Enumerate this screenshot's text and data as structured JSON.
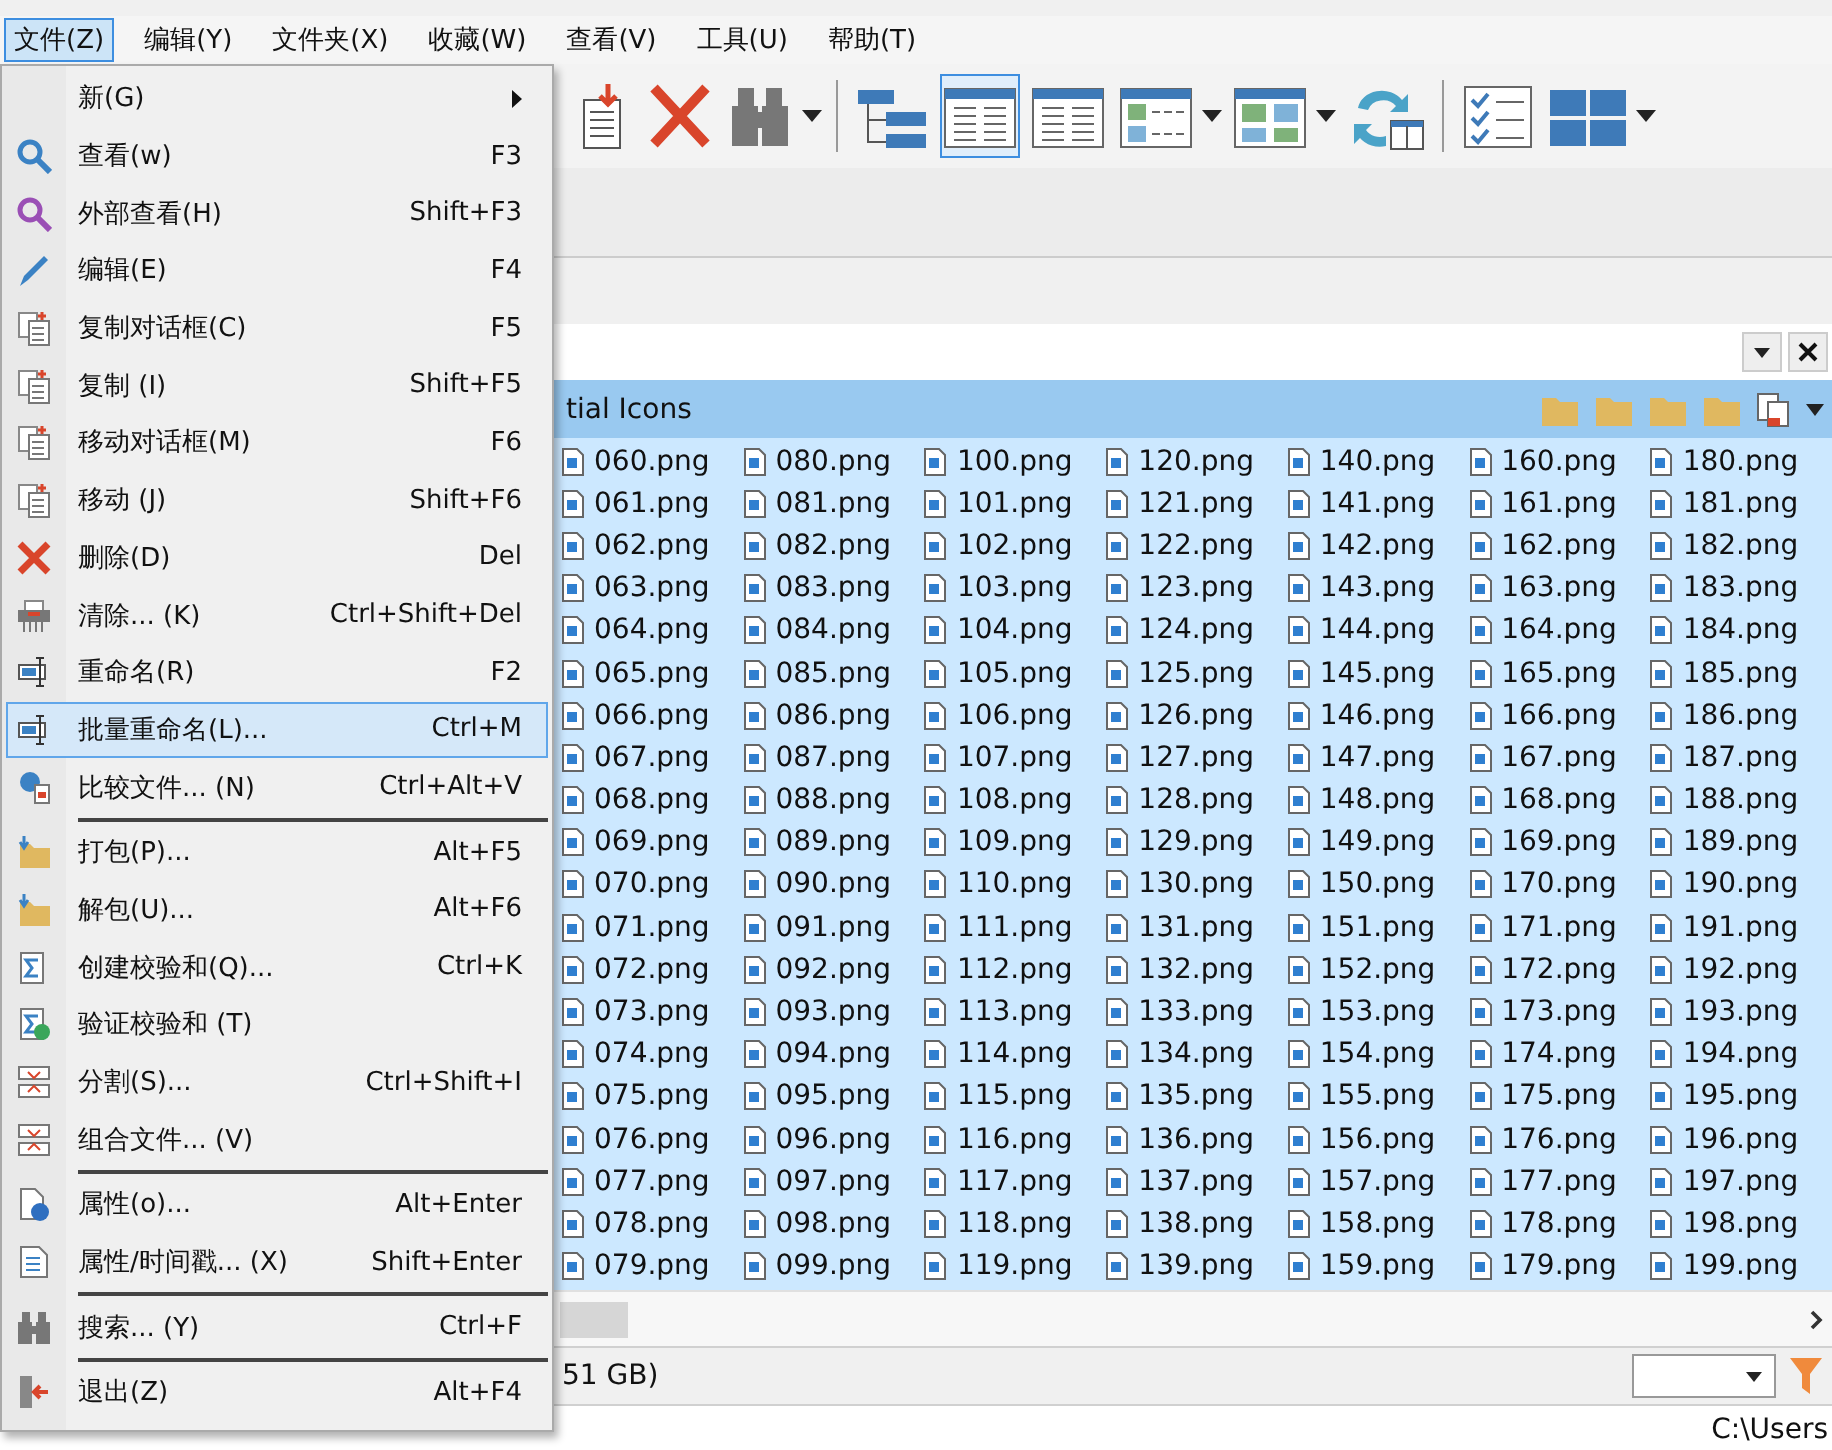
{
  "menubar": [
    {
      "label": "文件(Z)",
      "selected": true
    },
    {
      "label": "编辑(Y)",
      "selected": false
    },
    {
      "label": "文件夹(X)",
      "selected": false
    },
    {
      "label": "收藏(W)",
      "selected": false
    },
    {
      "label": "查看(V)",
      "selected": false
    },
    {
      "label": "工具(U)",
      "selected": false
    },
    {
      "label": "帮助(T)",
      "selected": false
    }
  ],
  "toolbar": [
    {
      "kind": "move",
      "selected": false
    },
    {
      "kind": "delete",
      "selected": false
    },
    {
      "kind": "search",
      "selected": false
    },
    {
      "kind": "tree",
      "selected": false
    },
    {
      "kind": "brief",
      "selected": true
    },
    {
      "kind": "details",
      "selected": false
    },
    {
      "kind": "thumblist",
      "selected": false
    },
    {
      "kind": "thumbs",
      "selected": false
    },
    {
      "kind": "sync",
      "selected": false
    },
    {
      "kind": "checklist",
      "selected": false
    },
    {
      "kind": "tiles",
      "selected": false
    }
  ],
  "file_menu": [
    {
      "kind": "submenu",
      "label": "新(G)",
      "selected": false
    },
    {
      "kind": "view",
      "label": "查看(w)",
      "shortcut": "F3",
      "selected": false
    },
    {
      "kind": "viewer",
      "label": "外部查看(H)",
      "shortcut": "Shift+F3",
      "selected": false
    },
    {
      "kind": "edit",
      "label": "编辑(E)",
      "shortcut": "F4",
      "selected": false
    },
    {
      "kind": "copy",
      "label": "复制对话框(C)",
      "shortcut": "F5",
      "selected": false
    },
    {
      "kind": "copy",
      "label": "复制 (I)",
      "shortcut": "Shift+F5",
      "selected": false
    },
    {
      "kind": "copy",
      "label": "移动对话框(M)",
      "shortcut": "F6",
      "selected": false
    },
    {
      "kind": "copy",
      "label": "移动 (J)",
      "shortcut": "Shift+F6",
      "selected": false
    },
    {
      "kind": "delete",
      "label": "删除(D)",
      "shortcut": "Del",
      "selected": false
    },
    {
      "kind": "wipe",
      "label": "清除... (K)",
      "shortcut": "Ctrl+Shift+Del",
      "selected": false
    },
    {
      "kind": "rename",
      "label": "重命名(R)",
      "shortcut": "F2",
      "selected": false
    },
    {
      "kind": "rename",
      "label": "批量重命名(L)...",
      "shortcut": "Ctrl+M",
      "selected": true
    },
    {
      "kind": "compare",
      "label": "比较文件... (N)",
      "shortcut": "Ctrl+Alt+V",
      "selected": false
    },
    {
      "kind": "separator"
    },
    {
      "kind": "pack",
      "label": "打包(P)...",
      "shortcut": "Alt+F5",
      "selected": false
    },
    {
      "kind": "pack",
      "label": "解包(U)...",
      "shortcut": "Alt+F6",
      "selected": false
    },
    {
      "kind": "checksum",
      "label": "创建校验和(Q)...",
      "shortcut": "Ctrl+K",
      "selected": false
    },
    {
      "kind": "verify",
      "label": "验证校验和 (T)",
      "selected": false
    },
    {
      "kind": "split",
      "label": "分割(S)...",
      "shortcut": "Ctrl+Shift+I",
      "selected": false
    },
    {
      "kind": "split",
      "label": "组合文件... (V)",
      "selected": false
    },
    {
      "kind": "separator"
    },
    {
      "kind": "properties",
      "label": "属性(o)...",
      "shortcut": "Alt+Enter",
      "selected": false
    },
    {
      "kind": "timestamp",
      "label": "属性/时间戳... (X)",
      "shortcut": "Shift+Enter",
      "selected": false
    },
    {
      "kind": "separator"
    },
    {
      "kind": "search",
      "label": "搜索... (Y)",
      "shortcut": "Ctrl+F",
      "selected": false
    },
    {
      "kind": "separator"
    },
    {
      "kind": "exit",
      "label": "退出(Z)",
      "shortcut": "Alt+F4",
      "selected": false
    }
  ],
  "panel": {
    "header": "tial Icons",
    "file_columns": [
      [
        "060.png",
        "061.png",
        "062.png",
        "063.png",
        "064.png",
        "065.png",
        "066.png",
        "067.png",
        "068.png",
        "069.png",
        "070.png",
        "071.png",
        "072.png",
        "073.png",
        "074.png",
        "075.png",
        "076.png",
        "077.png",
        "078.png",
        "079.png"
      ],
      [
        "080.png",
        "081.png",
        "082.png",
        "083.png",
        "084.png",
        "085.png",
        "086.png",
        "087.png",
        "088.png",
        "089.png",
        "090.png",
        "091.png",
        "092.png",
        "093.png",
        "094.png",
        "095.png",
        "096.png",
        "097.png",
        "098.png",
        "099.png"
      ],
      [
        "100.png",
        "101.png",
        "102.png",
        "103.png",
        "104.png",
        "105.png",
        "106.png",
        "107.png",
        "108.png",
        "109.png",
        "110.png",
        "111.png",
        "112.png",
        "113.png",
        "114.png",
        "115.png",
        "116.png",
        "117.png",
        "118.png",
        "119.png"
      ],
      [
        "120.png",
        "121.png",
        "122.png",
        "123.png",
        "124.png",
        "125.png",
        "126.png",
        "127.png",
        "128.png",
        "129.png",
        "130.png",
        "131.png",
        "132.png",
        "133.png",
        "134.png",
        "135.png",
        "136.png",
        "137.png",
        "138.png",
        "139.png"
      ],
      [
        "140.png",
        "141.png",
        "142.png",
        "143.png",
        "144.png",
        "145.png",
        "146.png",
        "147.png",
        "148.png",
        "149.png",
        "150.png",
        "151.png",
        "152.png",
        "153.png",
        "154.png",
        "155.png",
        "156.png",
        "157.png",
        "158.png",
        "159.png"
      ],
      [
        "160.png",
        "161.png",
        "162.png",
        "163.png",
        "164.png",
        "165.png",
        "166.png",
        "167.png",
        "168.png",
        "169.png",
        "170.png",
        "171.png",
        "172.png",
        "173.png",
        "174.png",
        "175.png",
        "176.png",
        "177.png",
        "178.png",
        "179.png"
      ],
      [
        "180.png",
        "181.png",
        "182.png",
        "183.png",
        "184.png",
        "185.png",
        "186.png",
        "187.png",
        "188.png",
        "189.png",
        "190.png",
        "191.png",
        "192.png",
        "193.png",
        "194.png",
        "195.png",
        "196.png",
        "197.png",
        "198.png",
        "199.png"
      ]
    ],
    "status": "51 GB)"
  },
  "path_bar": "C:\\Users"
}
